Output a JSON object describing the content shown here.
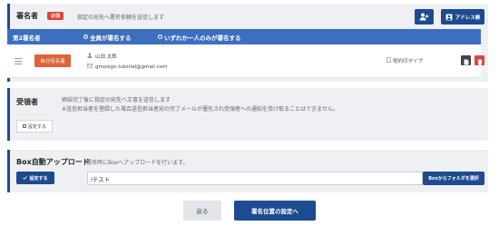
{
  "signer_section": {
    "title": "署名者",
    "required_badge": "必須",
    "description": "指定の宛先へ署名依頼を送信します",
    "address_book_label": "アドレス帳",
    "add_person_icon": "add-person-icon",
    "address_icon": "user-card-icon",
    "signer_bar": {
      "label": "第2署名者",
      "option_all": "全員が署名する",
      "option_any": "いずれか一人のみが署名する",
      "selected": "option_all"
    },
    "row": {
      "assign_button": "自分宛名者",
      "name": "山田 太郎",
      "email": "gmosign.tutorial@gmail.com",
      "contract_type": "契約印タイプ"
    }
  },
  "receiver_section": {
    "title": "受領者",
    "description_1": "締結完了後に指定の宛先へ文書を送信します",
    "description_2": "※送信担当者を登録した場合送信担当者宛の完了メールが優先され受領者への通知を受け取ることはできません。",
    "setting_button": "設定する"
  },
  "box_section": {
    "title": "Box自動アップロード",
    "description": "署名時にBoxへアップロードを行います。",
    "setting_button": "設定する",
    "path_value": "/テスト",
    "select_folder_button": "Boxからフォルダを選択"
  },
  "footer": {
    "back_button": "戻る",
    "next_button": "署名位置の設定へ"
  },
  "colors": {
    "navy": "#1d4b8f",
    "blue_bar": "#3d6fc0",
    "red": "#e0423a",
    "orange_red": "#e0623a"
  }
}
